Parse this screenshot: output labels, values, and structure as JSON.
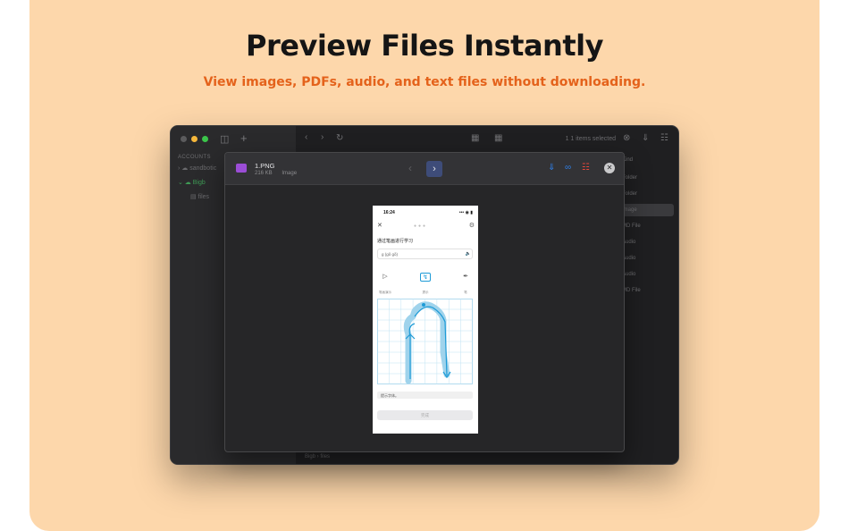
{
  "hero": {
    "title": "Preview Files Instantly",
    "subtitle": "View images, PDFs, audio, and text files without downloading."
  },
  "window": {
    "sidebar": {
      "section_label": "ACCOUNTS",
      "items": [
        "sandbotic",
        "Bigb",
        "files"
      ]
    },
    "status": "1 1 items selected",
    "list_header": "Kind",
    "kinds": [
      "Folder",
      "Folder",
      "Image",
      "MD File",
      "Audio",
      "Audio",
      "Audio",
      "MD File"
    ],
    "path": [
      "Bigb",
      "files"
    ]
  },
  "preview": {
    "file_name": "1.PNG",
    "file_size": "216 KB",
    "file_kind": "Image",
    "colors": {
      "accent_blue": "#2f7fe6",
      "delete_red": "#e3473b",
      "thumb_purple": "#9b4dd6"
    },
    "phone": {
      "time": "16:24",
      "status": "••• ◉ ▮",
      "question": "通过笔画进行学习",
      "pinyin": "g (gǒ gǒ)",
      "controls": [
        {
          "label": "笔画演示"
        },
        {
          "label": "提示"
        },
        {
          "label": "笔"
        }
      ],
      "hint": "提示字体。",
      "button": "完成"
    }
  }
}
